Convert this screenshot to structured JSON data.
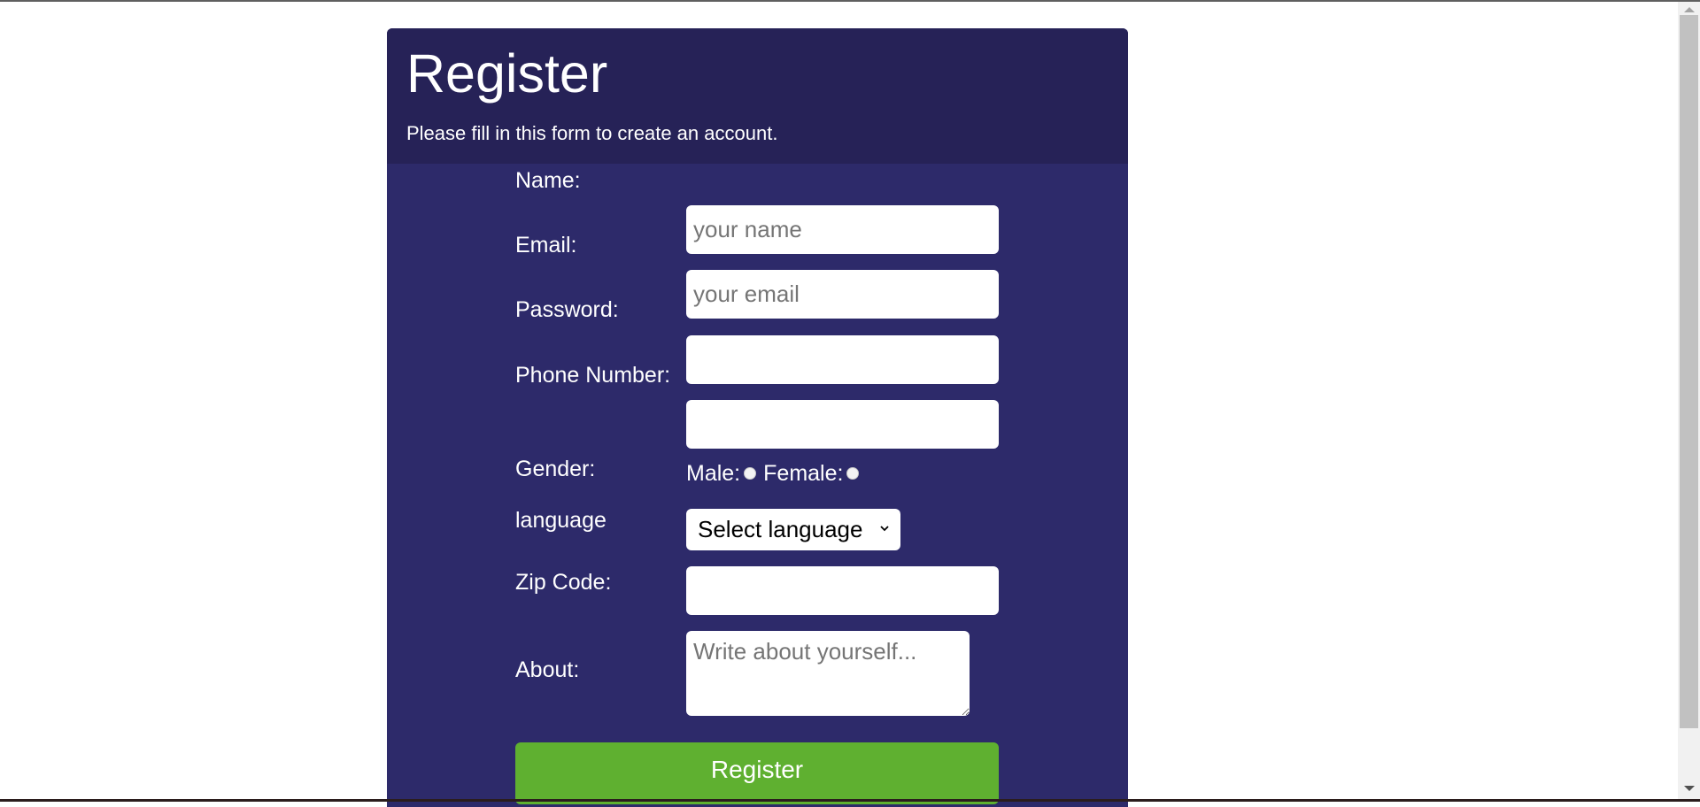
{
  "header": {
    "title": "Register",
    "subtitle": "Please fill in this form to create an account."
  },
  "form": {
    "name": {
      "label": "Name:",
      "placeholder": "your name",
      "value": ""
    },
    "email": {
      "label": "Email:",
      "placeholder": "your email",
      "value": ""
    },
    "password": {
      "label": "Password:",
      "value": ""
    },
    "phone": {
      "label": "Phone Number:",
      "value": ""
    },
    "gender": {
      "label": "Gender:",
      "options": [
        "Male:",
        "Female:"
      ],
      "selected": null
    },
    "language": {
      "label": "language",
      "selected": "Select language"
    },
    "zip": {
      "label": "Zip Code:",
      "value": ""
    },
    "about": {
      "label": "About:",
      "placeholder": "Write about yourself...",
      "value": ""
    },
    "submit_label": "Register"
  },
  "colors": {
    "header_bg": "#262257",
    "card_bg": "#2d2a6a",
    "button_bg": "#5fb030",
    "text": "#ffffff"
  }
}
